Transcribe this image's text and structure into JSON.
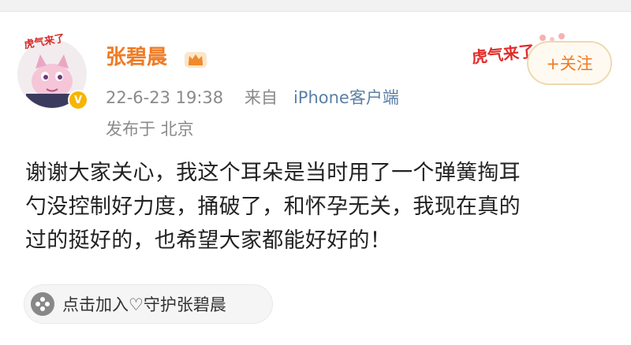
{
  "post": {
    "author": "张碧晨",
    "time": "22-6-23 19:38",
    "source_prefix": "来自",
    "source": "iPhone客户端",
    "location": "发布于 北京",
    "follow_label": "+关注",
    "avatar_caption": "虎气来了",
    "promo_text": "虎气来了",
    "content_lines": [
      "谢谢大家关心，我这个耳朵是当时用了一个弹簧掏耳",
      "勺没控制好力度，捅破了，和怀孕无关，我现在真的",
      "过的挺好的，也希望大家都能好好的！"
    ],
    "guard_label": "点击加入♡守护张碧晨"
  },
  "colors": {
    "username": "#ef7b25",
    "meta": "#8a8a8a",
    "source": "#5b7fa6",
    "follow_border": "#efd9b0",
    "verified_badge": "#f7b500"
  },
  "icons": {
    "crown": "crown-icon",
    "verified": "verified-badge-icon",
    "guard": "guard-flower-icon"
  }
}
